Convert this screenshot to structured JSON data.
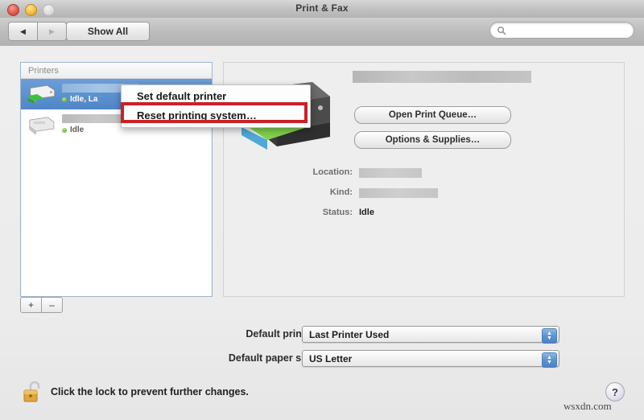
{
  "window": {
    "title": "Print & Fax",
    "traffic_lights": [
      "close",
      "minimize",
      "zoom"
    ]
  },
  "toolbar": {
    "back_glyph": "◀",
    "forward_glyph": "▶",
    "show_all_label": "Show All",
    "search_placeholder": "",
    "search_value": ""
  },
  "printer_list": {
    "header": "Printers",
    "items": [
      {
        "name": "",
        "name_redacted": true,
        "status": "Idle, La",
        "status_color": "#6aba2e",
        "selected": true
      },
      {
        "name": "",
        "name_redacted": true,
        "status": "Idle",
        "status_color": "#6aba2e",
        "selected": false
      }
    ],
    "add_label": "+",
    "remove_label": "–"
  },
  "detail": {
    "printer_name": "",
    "printer_name_redacted": true,
    "buttons": [
      {
        "label": "Open Print Queue…"
      },
      {
        "label": "Options & Supplies…"
      }
    ],
    "fields": [
      {
        "label": "Location:",
        "value": "",
        "redacted": true,
        "redact_width": 78
      },
      {
        "label": "Kind:",
        "value": "",
        "redacted": true,
        "redact_width": 98
      },
      {
        "label": "Status:",
        "value": "Idle",
        "redacted": false,
        "redact_width": 0
      }
    ]
  },
  "context_menu": {
    "items": [
      {
        "label": "Set default printer",
        "highlighted": false
      },
      {
        "label": "Reset printing system…",
        "highlighted": true
      }
    ],
    "highlight_color": "#cc2026"
  },
  "form": {
    "default_printer": {
      "label": "Default printer:",
      "value": "Last Printer Used"
    },
    "default_paper_size": {
      "label": "Default paper size:",
      "value": "US Letter"
    }
  },
  "footer": {
    "lock_text": "Click the lock to prevent further changes.",
    "lock_state": "unlocked",
    "help_label": "?",
    "watermark": "wsxdn.com"
  }
}
